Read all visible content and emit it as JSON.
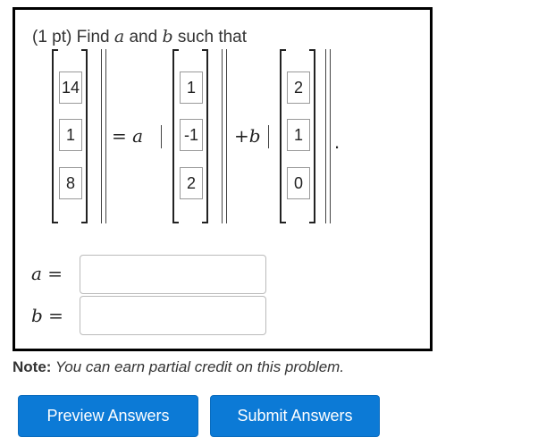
{
  "prompt": {
    "prefix": "(1 pt) Find ",
    "var_a": "a",
    "and_text": " and ",
    "var_b": "b",
    "suffix": " such that"
  },
  "matrices": {
    "lhs": [
      "14",
      "1",
      "8"
    ],
    "v1": [
      "1",
      "-1",
      "2"
    ],
    "v2": [
      "2",
      "1",
      "0"
    ]
  },
  "equation": {
    "eq_a": "= a",
    "plus_b": "+b",
    "period": "."
  },
  "answers": {
    "a_label": "a =",
    "b_label": "b ="
  },
  "note": {
    "label": "Note:",
    "text": " You can earn partial credit on this problem."
  },
  "buttons": {
    "preview": "Preview Answers",
    "submit": "Submit Answers"
  },
  "colors": {
    "button": "#0c7ad6"
  }
}
